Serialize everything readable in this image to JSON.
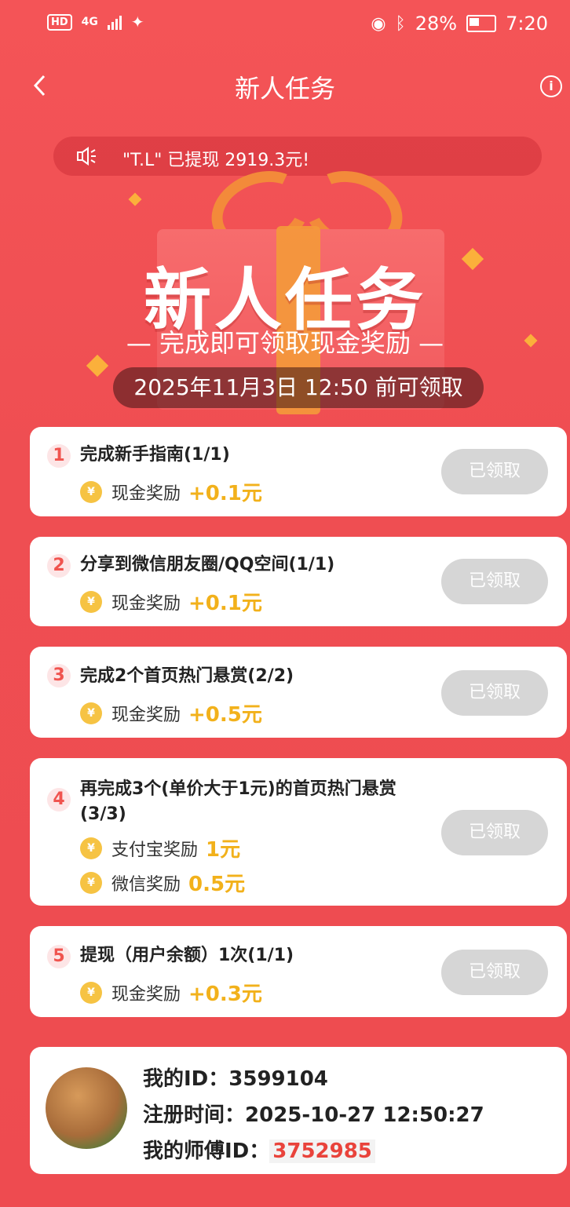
{
  "status_bar": {
    "hd": "HD",
    "network": "4G",
    "battery": "28%",
    "time": "7:20"
  },
  "nav": {
    "title": "新人任务"
  },
  "ticker": {
    "text": "\"T.L\" 已提现 2919.3元!"
  },
  "hero": {
    "title": "新人任务",
    "subtitle": "— 完成即可领取现金奖励 —",
    "deadline": "2025年11月3日 12:50 前可领取"
  },
  "tasks": [
    {
      "num": "1",
      "title": "完成新手指南(1/1)",
      "rewards": [
        {
          "label": "现金奖励",
          "value": "+0.1元"
        }
      ],
      "button": "已领取"
    },
    {
      "num": "2",
      "title": "分享到微信朋友圈/QQ空间(1/1)",
      "rewards": [
        {
          "label": "现金奖励",
          "value": "+0.1元"
        }
      ],
      "button": "已领取"
    },
    {
      "num": "3",
      "title": "完成2个首页热门悬赏(2/2)",
      "rewards": [
        {
          "label": "现金奖励",
          "value": "+0.5元"
        }
      ],
      "button": "已领取"
    },
    {
      "num": "4",
      "title": "再完成3个(单价大于1元)的首页热门悬赏(3/3)",
      "rewards": [
        {
          "label": "支付宝奖励",
          "value": "1元"
        },
        {
          "label": "微信奖励",
          "value": "0.5元"
        }
      ],
      "button": "已领取"
    },
    {
      "num": "5",
      "title": "提现（用户余额）1次(1/1)",
      "rewards": [
        {
          "label": "现金奖励",
          "value": "+0.3元"
        }
      ],
      "button": "已领取"
    }
  ],
  "profile": {
    "id_label": "我的ID：",
    "id_value": "3599104",
    "reg_label": "注册时间：",
    "reg_value": "2025-10-27 12:50:27",
    "master_label": "我的师傅ID：",
    "master_value": "3752985"
  },
  "colors": {
    "primary": "#ef4d52",
    "reward_gold": "#f2b11b",
    "button_disabled": "#d6d6d6"
  }
}
